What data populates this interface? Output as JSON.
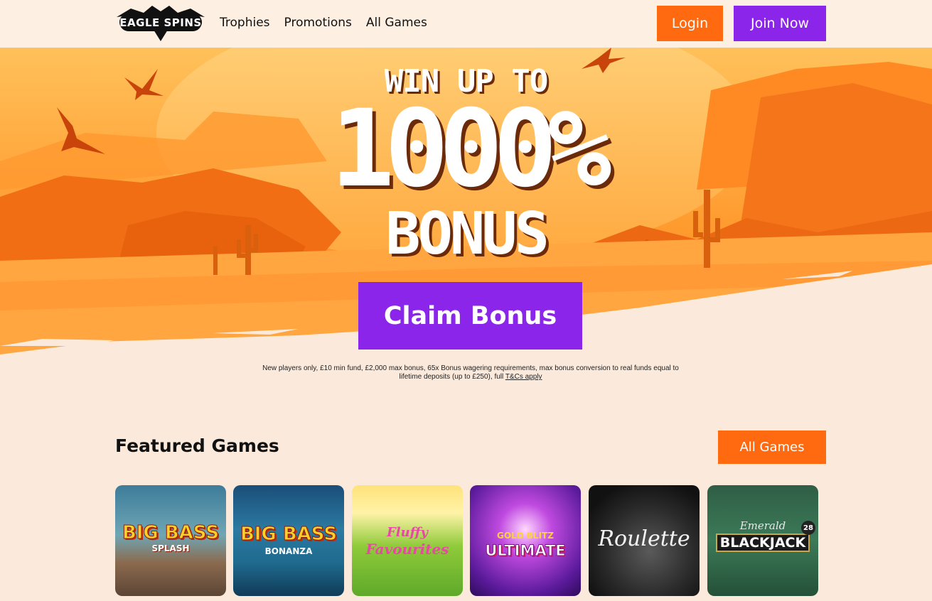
{
  "brand": {
    "logo_text": "EAGLE SPINS"
  },
  "nav": {
    "items": [
      "Trophies",
      "Promotions",
      "All Games"
    ]
  },
  "header": {
    "login_label": "Login",
    "join_label": "Join Now"
  },
  "hero": {
    "line1": "WIN UP TO",
    "line2": "1000%",
    "line3": "BONUS",
    "cta_label": "Claim Bonus",
    "terms_text": "New players only, £10 min fund, £2,000 max bonus, 65x Bonus wagering requirements, max bonus conversion to real funds equal to lifetime deposits (up to £250), full ",
    "terms_link": "T&Cs apply"
  },
  "featured": {
    "title": "Featured Games",
    "all_games_label": "All Games",
    "games": [
      {
        "line1": "BIG BASS",
        "line2": "SPLASH"
      },
      {
        "line1": "BIG BASS",
        "line2": "BONANZA"
      },
      {
        "line1": "Fluffy",
        "line2": "Favourites"
      },
      {
        "line1": "GOLD BLITZ",
        "line2": "ULTIMATE"
      },
      {
        "line1": "Roulette",
        "line2": ""
      },
      {
        "line1": "Emerald",
        "line2": "BLACKJACK",
        "badge": "28"
      }
    ]
  },
  "colors": {
    "orange": "#ff6a10",
    "purple": "#8b25ea",
    "page_bg": "#fbeadb"
  }
}
